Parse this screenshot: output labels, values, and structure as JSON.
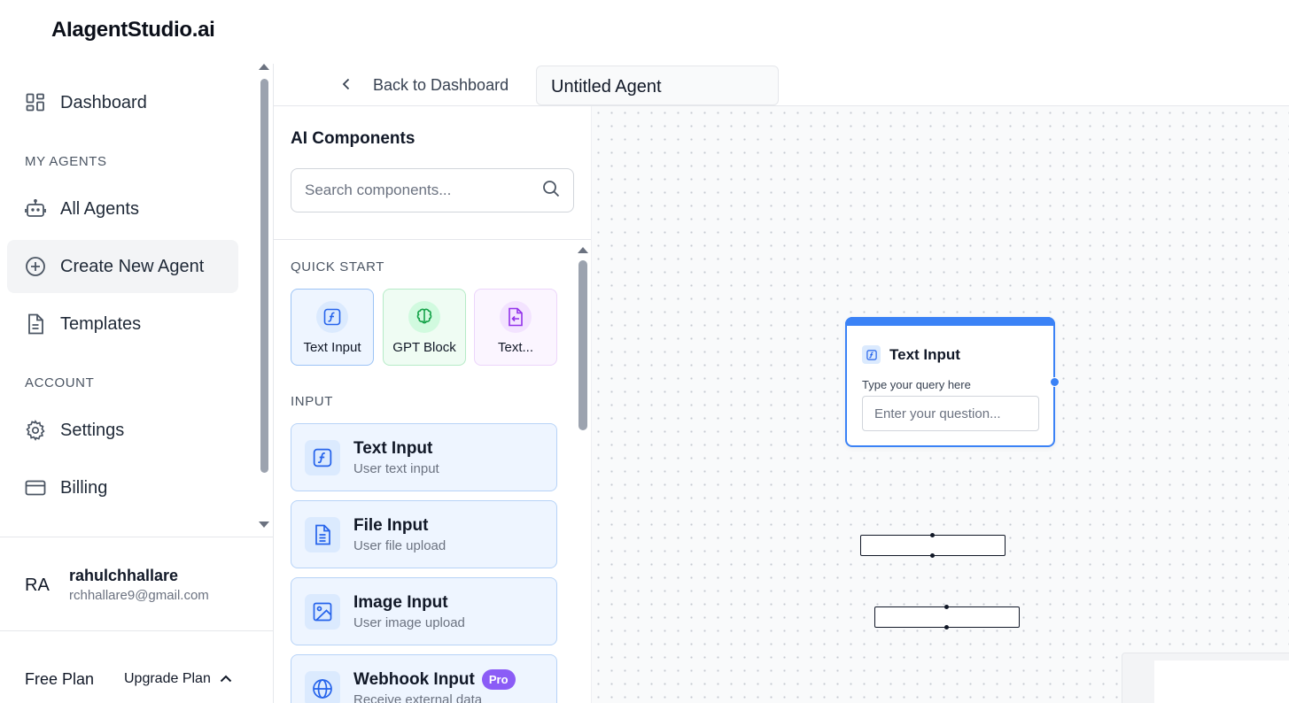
{
  "brand": "AIagentStudio.ai",
  "sidebar": {
    "nav": [
      {
        "label": "Dashboard",
        "icon": "dashboard-grid-icon"
      },
      {
        "label": "All Agents",
        "icon": "robot-icon"
      },
      {
        "label": "Create New Agent",
        "icon": "plus-circle-icon",
        "active": true
      },
      {
        "label": "Templates",
        "icon": "document-icon"
      },
      {
        "label": "Settings",
        "icon": "gear-icon"
      },
      {
        "label": "Billing",
        "icon": "credit-card-icon"
      }
    ],
    "section_my_agents": "MY AGENTS",
    "section_account": "ACCOUNT",
    "user": {
      "initials": "RA",
      "name": "rahulchhallare",
      "email": "rchhallare9@gmail.com"
    },
    "plan": {
      "name": "Free Plan",
      "upgrade_label": "Upgrade Plan"
    }
  },
  "topbar": {
    "back_label": "Back to Dashboard",
    "agent_name": "Untitled Agent"
  },
  "panel": {
    "title": "AI Components",
    "search_placeholder": "Search components...",
    "quick_start_label": "QUICK START",
    "quick_start": [
      {
        "label": "Text Input",
        "icon": "function-icon",
        "color": "#2563eb"
      },
      {
        "label": "GPT Block",
        "icon": "brain-icon",
        "color": "#16a34a"
      },
      {
        "label": "Text...",
        "icon": "text-output-icon",
        "color": "#9333ea"
      }
    ],
    "input_label": "INPUT",
    "input_components": [
      {
        "title": "Text Input",
        "subtitle": "User text input",
        "icon": "function-icon"
      },
      {
        "title": "File Input",
        "subtitle": "User file upload",
        "icon": "file-icon"
      },
      {
        "title": "Image Input",
        "subtitle": "User image upload",
        "icon": "image-icon"
      },
      {
        "title": "Webhook Input",
        "subtitle": "Receive external data",
        "icon": "globe-icon",
        "badge": "Pro"
      }
    ]
  },
  "canvas": {
    "node": {
      "title": "Text Input",
      "label": "Type your query here",
      "placeholder": "Enter your question..."
    }
  },
  "colors": {
    "accent": "#3b82f6",
    "pro_badge": "#8b5cf6"
  }
}
